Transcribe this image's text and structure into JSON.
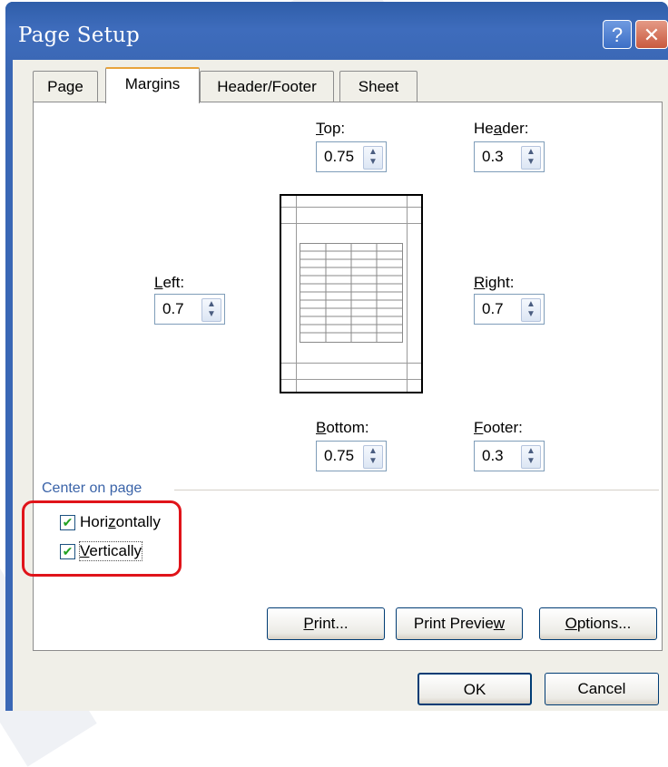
{
  "window": {
    "title": "Page Setup"
  },
  "titlebar_buttons": {
    "help": "?",
    "close": "✕"
  },
  "tabs": [
    {
      "label": "Page",
      "active": false
    },
    {
      "label": "Margins",
      "active": true
    },
    {
      "label": "Header/Footer",
      "active": false
    },
    {
      "label": "Sheet",
      "active": false
    }
  ],
  "margins": {
    "top": {
      "label_before": "",
      "label_key": "T",
      "label_after": "op:",
      "value": "0.75"
    },
    "header": {
      "label_before": "He",
      "label_key": "a",
      "label_after": "der:",
      "value": "0.3"
    },
    "left": {
      "label_before": "",
      "label_key": "L",
      "label_after": "eft:",
      "value": "0.7"
    },
    "right": {
      "label_before": "",
      "label_key": "R",
      "label_after": "ight:",
      "value": "0.7"
    },
    "bottom": {
      "label_before": "",
      "label_key": "B",
      "label_after": "ottom:",
      "value": "0.75"
    },
    "footer": {
      "label_before": "",
      "label_key": "F",
      "label_after": "ooter:",
      "value": "0.3"
    }
  },
  "center_on_page": {
    "heading": "Center on page",
    "horizontally": {
      "label_before": "Hori",
      "label_key": "z",
      "label_after": "ontally",
      "checked": true
    },
    "vertically": {
      "label_before": "",
      "label_key": "V",
      "label_after": "ertically",
      "checked": true
    }
  },
  "buttons": {
    "print": {
      "before": "",
      "key": "P",
      "after": "rint..."
    },
    "print_preview": {
      "before": "Print Previe",
      "key": "w",
      "after": ""
    },
    "options": {
      "before": "",
      "key": "O",
      "after": "ptions..."
    },
    "ok": "OK",
    "cancel": "Cancel"
  },
  "colors": {
    "title_bar": "#3a67b5",
    "highlight": "#e0141a",
    "active_tab_accent": "#e8a33c",
    "group_label": "#3a63a8"
  }
}
